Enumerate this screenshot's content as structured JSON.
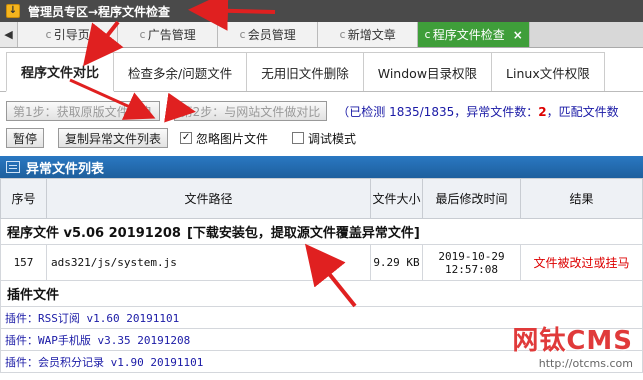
{
  "window": {
    "title": "管理员专区→程序文件检查",
    "icon_glyph": "↓"
  },
  "tabs": [
    {
      "label": "引导页",
      "prefix": "c"
    },
    {
      "label": "广告管理",
      "prefix": "c"
    },
    {
      "label": "会员管理",
      "prefix": "c"
    },
    {
      "label": "新增文章",
      "prefix": "c"
    },
    {
      "label": "程序文件检查",
      "prefix": "c",
      "active": true,
      "close": "×"
    }
  ],
  "tabs_nav": {
    "prev": "◀"
  },
  "subtabs": [
    "程序文件对比",
    "检查多余/问题文件",
    "无用旧文件删除",
    "Window目录权限",
    "Linux文件权限"
  ],
  "steps": {
    "step1": "第1步：获取原版文件信息",
    "step2": "第2步：与网站文件做对比",
    "status_prefix": "（已检测 1835/1835，异常文件数：",
    "abnormal_count": "2",
    "status_suffix": "，匹配文件数"
  },
  "controls": {
    "pause": "暂停",
    "copy": "复制异常文件列表",
    "ignore_images": "忽略图片文件",
    "ignore_images_checked": "✓",
    "debug_mode": "调试模式"
  },
  "section": {
    "title": "异常文件列表"
  },
  "table": {
    "headers": [
      "序号",
      "文件路径",
      "文件大小",
      "最后修改时间",
      "结果"
    ],
    "group_title": "程序文件 v5.06 20191208",
    "group_note": "[下载安装包，提取源文件覆盖异常文件]",
    "rows": [
      {
        "no": "157",
        "path": "ads321/js/system.js",
        "size": "9.29 KB",
        "date": "2019-10-29",
        "time": "12:57:08",
        "result": "文件被改过或挂马"
      }
    ]
  },
  "plugins": {
    "title": "插件文件",
    "items": [
      "插件：RSS订阅 v1.60 20191101",
      "插件：WAP手机版 v3.35 20191208",
      "插件：会员积分记录 v1.90 20191101"
    ]
  },
  "watermark": {
    "brand": "网钛CMS",
    "url": "http://otcms.com"
  },
  "colors": {
    "accent_tab": "#3f9e3a",
    "section_blue": "#1e5f9d",
    "alert_red": "#dd0000",
    "arrow_red": "#e02020"
  }
}
